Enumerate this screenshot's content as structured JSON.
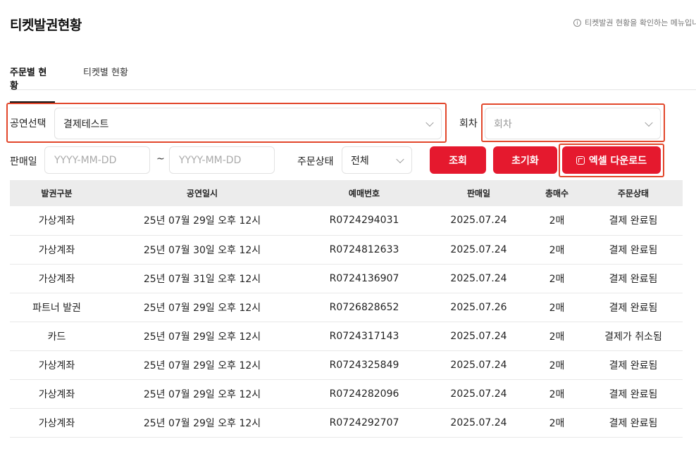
{
  "header": {
    "title": "티켓발권현황",
    "info_note": "티켓발권 현황을 확인하는 메뉴입니"
  },
  "tabs": [
    {
      "label": "주문별 현황",
      "active": true
    },
    {
      "label": "티켓별 현황",
      "active": false
    }
  ],
  "filters": {
    "performance_label": "공연선택",
    "performance_value": "결제테스트",
    "round_label": "회차",
    "round_placeholder": "회차",
    "sale_date_label": "판매일",
    "date_from_placeholder": "YYYY-MM-DD",
    "date_to_placeholder": "YYYY-MM-DD",
    "date_separator": "~",
    "order_status_label": "주문상태",
    "order_status_value": "전체"
  },
  "buttons": {
    "search": "조회",
    "reset": "초기화",
    "excel": "엑셀 다운로드"
  },
  "colors": {
    "accent": "#e5192e",
    "highlight_border": "#e2472b",
    "table_header_bg": "#ececec"
  },
  "table": {
    "columns": [
      "발권구분",
      "공연일시",
      "예매번호",
      "판매일",
      "총매수",
      "주문상태"
    ],
    "rows": [
      [
        "가상계좌",
        "25년 07월 29일 오후 12시",
        "R0724294031",
        "2025.07.24",
        "2매",
        "결제 완료됨"
      ],
      [
        "가상계좌",
        "25년 07월 30일 오후 12시",
        "R0724812633",
        "2025.07.24",
        "2매",
        "결제 완료됨"
      ],
      [
        "가상계좌",
        "25년 07월 31일 오후 12시",
        "R0724136907",
        "2025.07.24",
        "2매",
        "결제 완료됨"
      ],
      [
        "파트너 발권",
        "25년 07월 29일 오후 12시",
        "R0726828652",
        "2025.07.26",
        "2매",
        "결제 완료됨"
      ],
      [
        "카드",
        "25년 07월 29일 오후 12시",
        "R0724317143",
        "2025.07.24",
        "2매",
        "결제가 취소됨"
      ],
      [
        "가상계좌",
        "25년 07월 29일 오후 12시",
        "R0724325849",
        "2025.07.24",
        "2매",
        "결제 완료됨"
      ],
      [
        "가상계좌",
        "25년 07월 29일 오후 12시",
        "R0724282096",
        "2025.07.24",
        "2매",
        "결제 완료됨"
      ],
      [
        "가상계좌",
        "25년 07월 29일 오후 12시",
        "R0724292707",
        "2025.07.24",
        "2매",
        "결제 완료됨"
      ]
    ]
  }
}
